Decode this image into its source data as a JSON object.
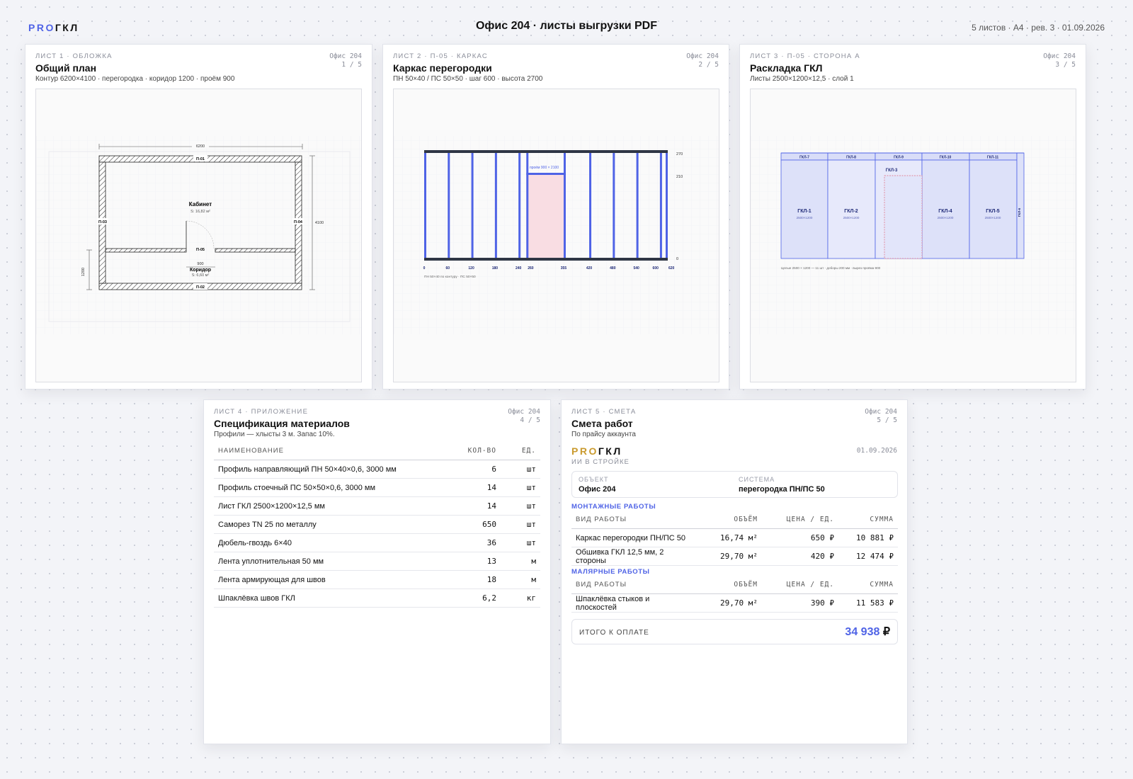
{
  "header": {
    "logo_pro": "PRO",
    "logo_gkl": "ГКЛ",
    "title": "Офис 204 · листы выгрузки PDF",
    "meta": "5 листов · А4 · рев. 3 · 01.09.2026"
  },
  "sheets": [
    {
      "tag": "ЛИСТ 1 · ОБЛОЖКА",
      "project": "Офис 204",
      "page": "1 / 5",
      "title": "Общий план",
      "subtitle": "Контур 6200×4100 · перегородка · коридор 1200 · проём 900",
      "plan": {
        "dim_width": "6200",
        "dim_height": "4100",
        "dim_corridor": "1200",
        "dim_opening": "900",
        "wall_p01": "П-01",
        "wall_p02": "П-02",
        "wall_p03": "П-03",
        "wall_p04": "П-04",
        "wall_p05": "П-05",
        "room1_name": "Кабинет",
        "room1_area": "S: 16,82 м²",
        "room2_name": "Коридор",
        "room2_area": "S: 6,60 м²"
      }
    },
    {
      "tag": "ЛИСТ 2 · П-05 · КАРКАС",
      "project": "Офис 204",
      "page": "2 / 5",
      "title": "Каркас перегородки",
      "subtitle": "ПН 50×40 / ПС 50×50 · шаг 600 · высота 2700",
      "frame": {
        "opening_label": "проём 900 × 2100",
        "height_top": "270",
        "height_opening": "210",
        "height_zero": "0",
        "stud_positions": [
          0,
          60,
          120,
          180,
          240,
          260,
          355,
          420,
          480,
          540,
          600,
          620
        ],
        "opening_from": 260,
        "opening_to": 355,
        "total_length": 620,
        "legend": "ПН 50×40 по контуру · ПС 50×50"
      }
    },
    {
      "tag": "ЛИСТ 3 · П-05 · СТОРОНА А",
      "project": "Офис 204",
      "page": "3 / 5",
      "title": "Раскладка ГКЛ",
      "subtitle": "Листы 2500×1200×12,5 · слой 1",
      "layout": {
        "top_strips": [
          "ГКЛ-7",
          "ГКЛ-8",
          "ГКЛ-9",
          "ГКЛ-10",
          "ГКЛ-11"
        ],
        "sheets": [
          {
            "name": "ГКЛ-1",
            "size": "2500×1200"
          },
          {
            "name": "ГКЛ-2",
            "size": "2500×1200"
          },
          {
            "name": "ГКЛ-3",
            "size": ""
          },
          {
            "name": "ГКЛ-4",
            "size": "2500×1200"
          },
          {
            "name": "ГКЛ-5",
            "size": "2500×1200"
          }
        ],
        "edge_strip": "ГКЛ-6",
        "legend": "Целые 2500 × 1200 — 11 шт · доборы 200 мм · вырез проёма 900"
      }
    },
    {
      "tag": "ЛИСТ 4 · ПРИЛОЖЕНИЕ",
      "project": "Офис 204",
      "page": "4 / 5",
      "title": "Спецификация материалов",
      "subtitle": "Профили — хлысты 3 м. Запас 10%.",
      "columns": {
        "name": "НАИМЕНОВАНИЕ",
        "qty": "КОЛ-ВО",
        "unit": "ЕД."
      },
      "rows": [
        {
          "name": "Профиль направляющий ПН 50×40×0,6, 3000 мм",
          "qty": "6",
          "unit": "шт"
        },
        {
          "name": "Профиль стоечный ПС 50×50×0,6, 3000 мм",
          "qty": "14",
          "unit": "шт"
        },
        {
          "name": "Лист ГКЛ 2500×1200×12,5 мм",
          "qty": "14",
          "unit": "шт"
        },
        {
          "name": "Саморез TN 25 по металлу",
          "qty": "650",
          "unit": "шт"
        },
        {
          "name": "Дюбель-гвоздь 6×40",
          "qty": "36",
          "unit": "шт"
        },
        {
          "name": "Лента уплотнительная 50 мм",
          "qty": "13",
          "unit": "м"
        },
        {
          "name": "Лента армирующая для швов",
          "qty": "18",
          "unit": "м"
        },
        {
          "name": "Шпаклёвка швов ГКЛ",
          "qty": "6,2",
          "unit": "кг"
        }
      ]
    },
    {
      "tag": "ЛИСТ 5 · СМЕТА",
      "project": "Офис 204",
      "page": "5 / 5",
      "title": "Смета работ",
      "subtitle": "По прайсу аккаунта",
      "brand_pro": "PRO",
      "brand_gkl": "ГКЛ",
      "slogan": "ИИ В СТРОЙКЕ",
      "date": "01.09.2026",
      "object_label": "ОБЪЕКТ",
      "object_value": "Офис 204",
      "system_label": "СИСТЕМА",
      "system_value": "перегородка ПН/ПС 50",
      "columns": {
        "work": "ВИД РАБОТЫ",
        "volume": "ОБЪЁМ",
        "price": "ЦЕНА / ЕД.",
        "sum": "СУММА"
      },
      "sections": [
        {
          "title": "МОНТАЖНЫЕ РАБОТЫ",
          "rows": [
            {
              "work": "Каркас перегородки ПН/ПС 50",
              "volume": "16,74 м²",
              "price": "650 ₽",
              "sum": "10 881 ₽"
            },
            {
              "work": "Обшивка ГКЛ 12,5 мм, 2 стороны",
              "volume": "29,70 м²",
              "price": "420 ₽",
              "sum": "12 474 ₽"
            }
          ]
        },
        {
          "title": "МАЛЯРНЫЕ РАБОТЫ",
          "rows": [
            {
              "work": "Шпаклёвка стыков и плоскостей",
              "volume": "29,70 м²",
              "price": "390 ₽",
              "sum": "11 583 ₽"
            }
          ]
        }
      ],
      "total_label": "ИТОГО К ОПЛАТЕ",
      "total_value": "34 938",
      "total_currency": "₽"
    }
  ],
  "colors": {
    "accent": "#4f63e6",
    "brand_gold": "#c99a2e",
    "frame_profile": "#4f63e6",
    "track_profile": "#2f3645",
    "opening_fill": "#f9dde3"
  }
}
